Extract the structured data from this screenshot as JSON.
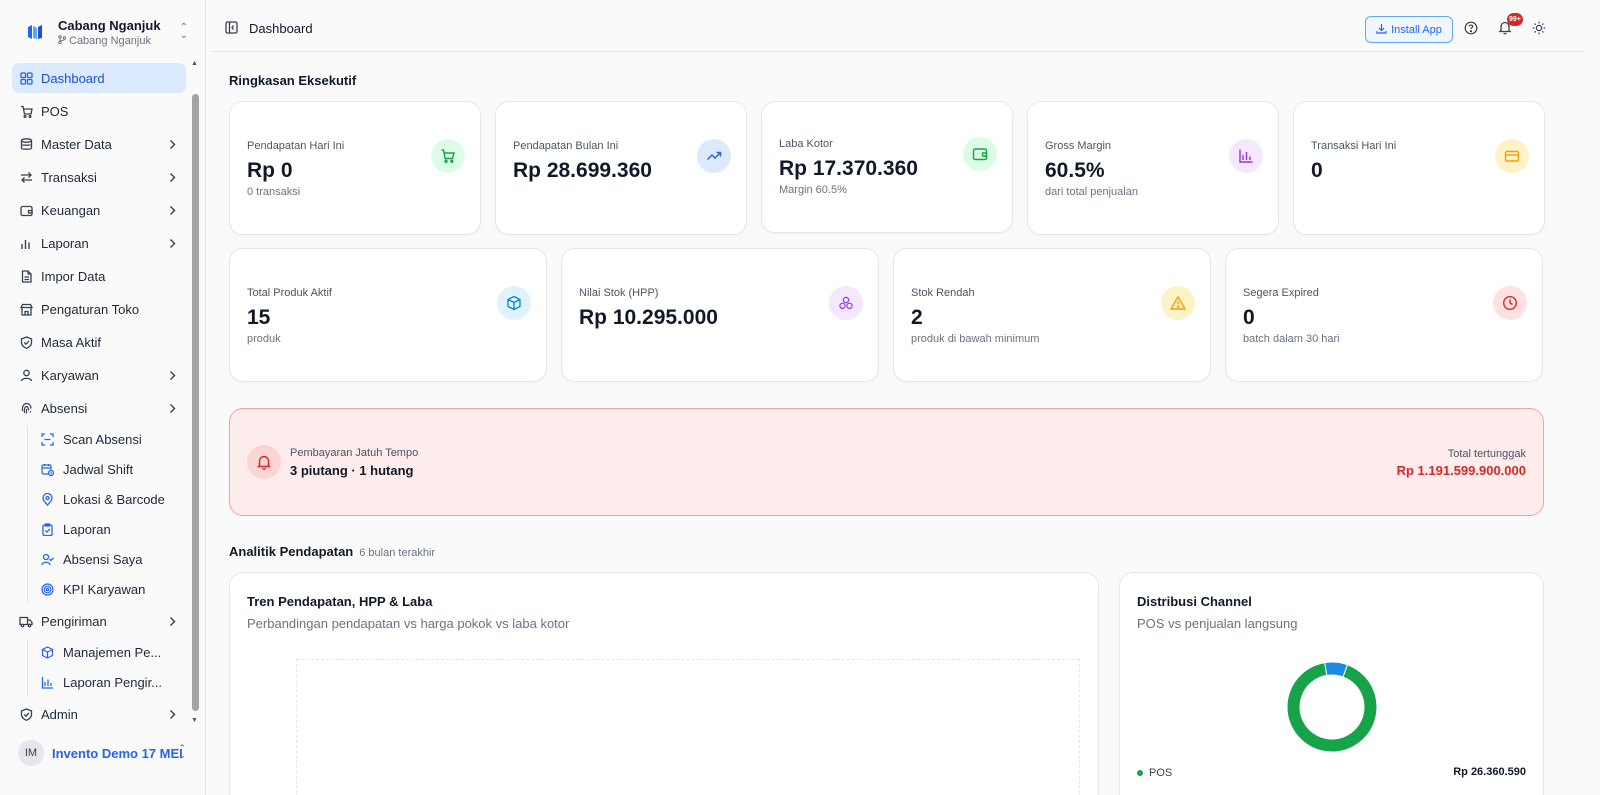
{
  "brand": {
    "name": "Cabang Nganjuk",
    "branch": "Cabang Nganjuk"
  },
  "sidebar": {
    "items": [
      {
        "label": "Dashboard"
      },
      {
        "label": "POS"
      },
      {
        "label": "Master Data"
      },
      {
        "label": "Transaksi"
      },
      {
        "label": "Keuangan"
      },
      {
        "label": "Laporan"
      },
      {
        "label": "Impor Data"
      },
      {
        "label": "Pengaturan Toko"
      },
      {
        "label": "Masa Aktif"
      },
      {
        "label": "Karyawan"
      },
      {
        "label": "Absensi"
      },
      {
        "label": "Pengiriman"
      },
      {
        "label": "Admin"
      }
    ],
    "absensi_sub": [
      {
        "label": "Scan Absensi"
      },
      {
        "label": "Jadwal Shift"
      },
      {
        "label": "Lokasi & Barcode"
      },
      {
        "label": "Laporan"
      },
      {
        "label": "Absensi Saya"
      },
      {
        "label": "KPI Karyawan"
      }
    ],
    "pengiriman_sub": [
      {
        "label": "Manajemen Pe..."
      },
      {
        "label": "Laporan Pengir..."
      }
    ]
  },
  "user": {
    "initials": "IM",
    "name": "Invento Demo 17 MEI"
  },
  "topbar": {
    "title": "Dashboard",
    "install_label": "Install App",
    "notif_badge": "99+"
  },
  "summary": {
    "title": "Ringkasan Eksekutif",
    "row1": [
      {
        "label": "Pendapatan Hari Ini",
        "value": "Rp 0",
        "note": "0 transaksi",
        "icon": "cart-icon",
        "color": "#16a34a",
        "bg": "#dcfce7"
      },
      {
        "label": "Pendapatan Bulan Ini",
        "value": "Rp 28.699.360",
        "note": "",
        "icon": "trending-up-icon",
        "color": "#2563eb",
        "bg": "#dbeafe"
      },
      {
        "label": "Laba Kotor",
        "value": "Rp 17.370.360",
        "note": "Margin 60.5%",
        "icon": "wallet-icon",
        "color": "#16a34a",
        "bg": "#dcfce7"
      },
      {
        "label": "Gross Margin",
        "value": "60.5%",
        "note": "dari total penjualan",
        "icon": "bar-chart-icon",
        "color": "#9333ea",
        "bg": "#f3e8ff"
      },
      {
        "label": "Transaksi Hari Ini",
        "value": "0",
        "note": "",
        "icon": "credit-card-icon",
        "color": "#f59e0b",
        "bg": "#fef3c7"
      }
    ],
    "row2": [
      {
        "label": "Total Produk Aktif",
        "value": "15",
        "note": "produk",
        "icon": "box-icon",
        "color": "#0284c7",
        "bg": "#e0f2fe"
      },
      {
        "label": "Nilai Stok (HPP)",
        "value": "Rp 10.295.000",
        "note": "",
        "icon": "boxes-icon",
        "color": "#9333ea",
        "bg": "#f3e8ff"
      },
      {
        "label": "Stok Rendah",
        "value": "2",
        "note": "produk di bawah minimum",
        "icon": "warning-icon",
        "color": "#f59e0b",
        "bg": "#fef3c7"
      },
      {
        "label": "Segera Expired",
        "value": "0",
        "note": "batch dalam 30 hari",
        "icon": "clock-icon",
        "color": "#dc2626",
        "bg": "#fee2e2"
      }
    ]
  },
  "alert": {
    "label": "Pembayaran Jatuh Tempo",
    "text": "3 piutang · 1 hutang",
    "right_label": "Total tertunggak",
    "right_value": "Rp 1.191.599.900.000"
  },
  "analytics": {
    "title": "Analitik Pendapatan",
    "subtitle": "6 bulan terakhir",
    "trend": {
      "title": "Tren Pendapatan, HPP & Laba",
      "subtitle": "Perbandingan pendapatan vs harga pokok vs laba kotor"
    },
    "channel": {
      "title": "Distribusi Channel",
      "subtitle": "POS vs penjualan langsung",
      "legend_label": "POS",
      "legend_value": "Rp 26.360.590"
    }
  },
  "chart_data": {
    "type": "pie",
    "categories": [
      "POS",
      ""
    ],
    "values": [
      26360590,
      2338770
    ],
    "colors": [
      "#16a34a",
      "#1e88e5"
    ]
  }
}
